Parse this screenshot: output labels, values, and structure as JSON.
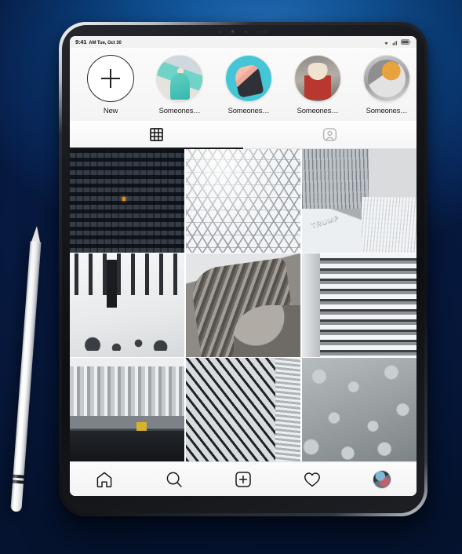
{
  "device": {
    "type": "tablet",
    "accessory": "stylus-pencil",
    "background_color": "#0d4a92"
  },
  "status_bar": {
    "time": "9:41",
    "date": "AM Tue, Oct 30",
    "icons": [
      "wifi-icon",
      "signal-icon",
      "battery-icon"
    ]
  },
  "stories": {
    "items": [
      {
        "label": "New",
        "type": "add-story",
        "icon": "plus-icon"
      },
      {
        "label": "Someones…",
        "type": "story-avatar"
      },
      {
        "label": "Someones…",
        "type": "story-avatar"
      },
      {
        "label": "Someones…",
        "type": "story-avatar"
      },
      {
        "label": "Someones…",
        "type": "story-avatar"
      }
    ]
  },
  "tabs": [
    {
      "name": "grid-tab",
      "icon": "grid-icon",
      "active": true
    },
    {
      "name": "tagged-tab",
      "icon": "tagged-person-icon",
      "active": false
    }
  ],
  "photo_grid": {
    "columns": 3,
    "cells": [
      {
        "id": "photo-1",
        "caption": "Dark high-rise facade with lit window"
      },
      {
        "id": "photo-2",
        "caption": "Glass lattice roof structure"
      },
      {
        "id": "photo-3",
        "caption": "Tower facade with TRUMP signage",
        "wordmark": "TRUMP"
      },
      {
        "id": "photo-4",
        "caption": "White plaza with pedestrians and banner"
      },
      {
        "id": "photo-5",
        "caption": "Gothic cathedral stonework from below"
      },
      {
        "id": "photo-6",
        "caption": "Apartment building balconies"
      },
      {
        "id": "photo-7",
        "caption": "City skyline over river with yellow cab"
      },
      {
        "id": "photo-8",
        "caption": "Diagonal skyscraper window grid"
      },
      {
        "id": "photo-9",
        "caption": "Cobblestone pavement texture"
      }
    ]
  },
  "bottom_nav": [
    {
      "name": "home",
      "icon": "home-icon"
    },
    {
      "name": "search",
      "icon": "search-icon"
    },
    {
      "name": "create",
      "icon": "plus-square-icon"
    },
    {
      "name": "activity",
      "icon": "heart-icon"
    },
    {
      "name": "profile",
      "icon": "profile-avatar"
    }
  ]
}
